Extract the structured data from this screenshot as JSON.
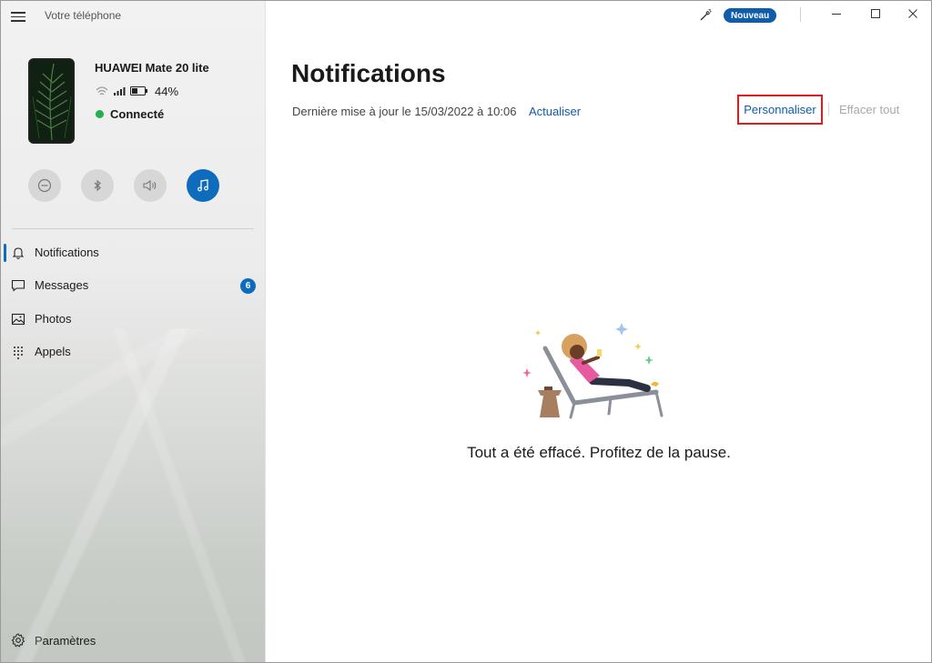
{
  "app": {
    "title": "Votre téléphone"
  },
  "device": {
    "name": "HUAWEI Mate 20 lite",
    "battery": "44%",
    "status": "Connecté",
    "status_color": "#1fb34a"
  },
  "quick_actions": [
    {
      "name": "do-not-disturb",
      "icon": "minus-circle-icon",
      "active": false
    },
    {
      "name": "bluetooth",
      "icon": "bluetooth-icon",
      "active": false
    },
    {
      "name": "volume",
      "icon": "speaker-icon",
      "active": false
    },
    {
      "name": "music",
      "icon": "music-note-icon",
      "active": true
    }
  ],
  "nav": {
    "items": [
      {
        "label": "Notifications",
        "icon": "bell-icon",
        "selected": true
      },
      {
        "label": "Messages",
        "icon": "chat-icon",
        "badge": "6"
      },
      {
        "label": "Photos",
        "icon": "image-icon"
      },
      {
        "label": "Appels",
        "icon": "dialpad-icon"
      }
    ],
    "settings_label": "Paramètres"
  },
  "titlebar": {
    "new_label": "Nouveau"
  },
  "main": {
    "title": "Notifications",
    "last_update": "Dernière mise à jour le 15/03/2022 à 10:06",
    "refresh_label": "Actualiser",
    "personalize_label": "Personnaliser",
    "clear_all_label": "Effacer tout",
    "empty_message": "Tout a été effacé. Profitez de la pause."
  },
  "colors": {
    "accent": "#0f6cbd",
    "highlight_border": "#e01c1c"
  }
}
